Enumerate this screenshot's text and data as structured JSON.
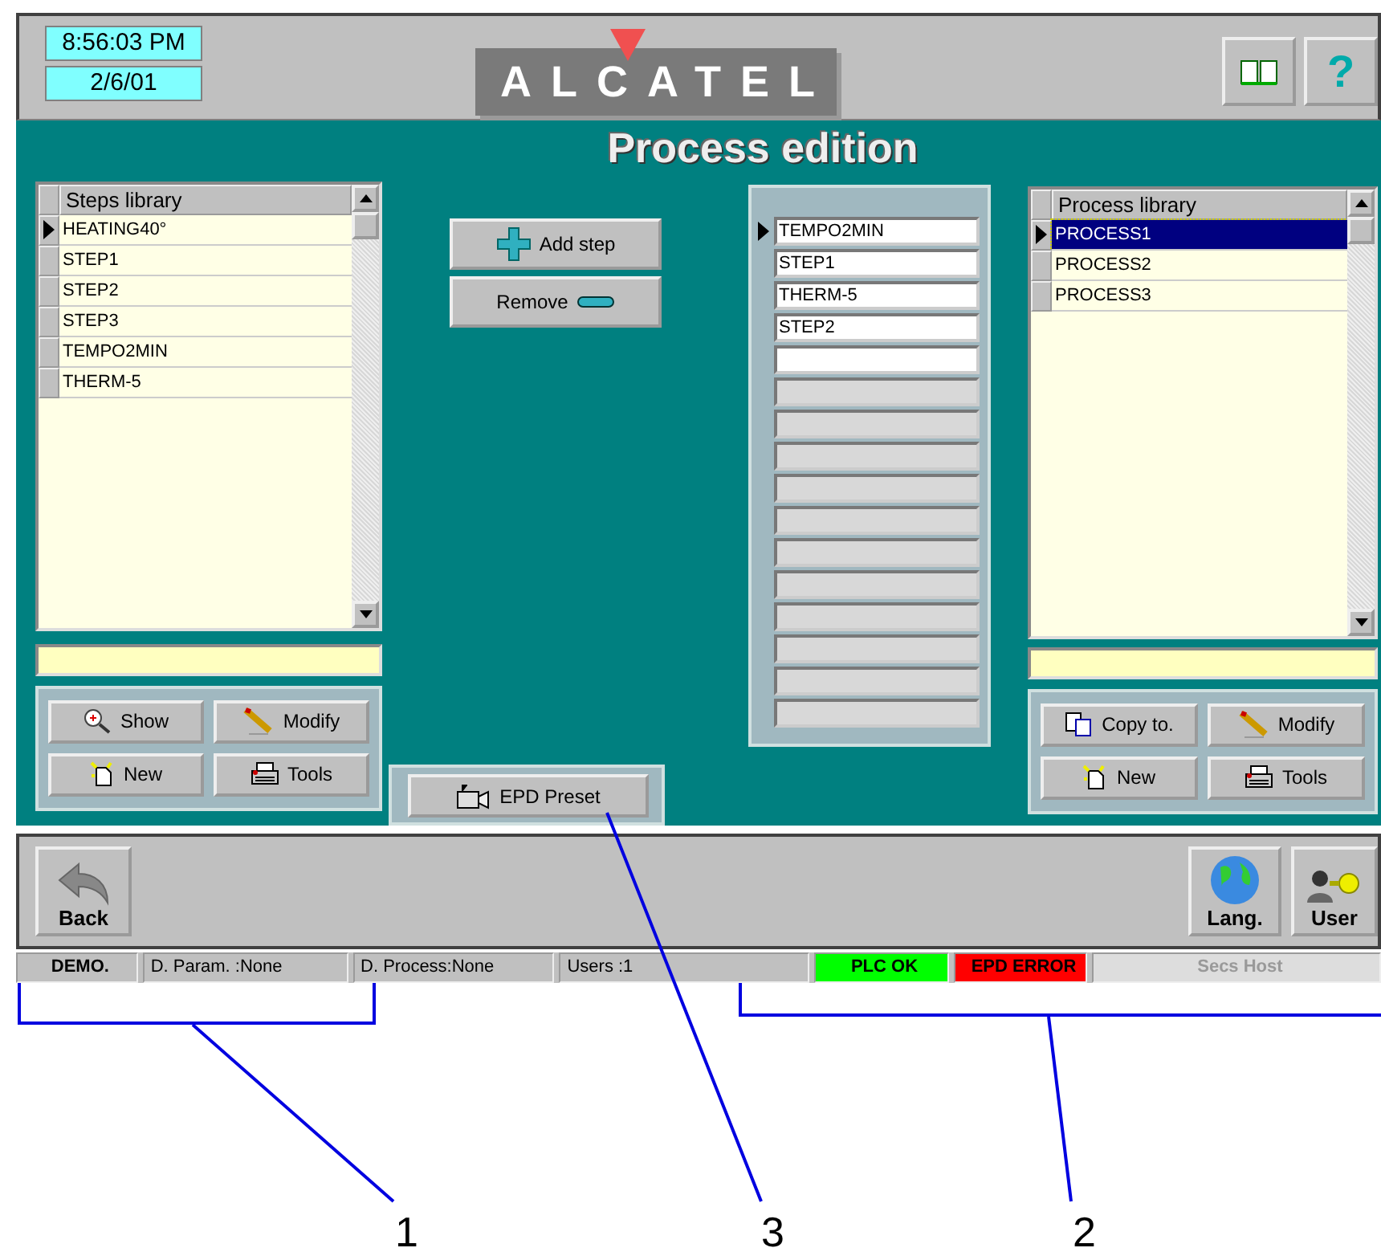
{
  "header": {
    "time": "8:56:03 PM",
    "date": "2/6/01",
    "logo": "ALCATEL",
    "help_button": "?"
  },
  "title": "Process edition",
  "steps_library": {
    "header": "Steps library",
    "rows": [
      {
        "name": "HEATING40°",
        "selected": true
      },
      {
        "name": "STEP1",
        "selected": false
      },
      {
        "name": "STEP2",
        "selected": false
      },
      {
        "name": "STEP3",
        "selected": false
      },
      {
        "name": "TEMPO2MIN",
        "selected": false
      },
      {
        "name": "THERM-5",
        "selected": false
      }
    ]
  },
  "steps_buttons": [
    {
      "label": "Show",
      "kind": "show"
    },
    {
      "label": "Modify",
      "kind": "modify"
    },
    {
      "label": "New",
      "kind": "new"
    },
    {
      "label": "Tools",
      "kind": "tools"
    }
  ],
  "edit_buttons": [
    {
      "label": "Add step",
      "kind": "add"
    },
    {
      "label": "Remove",
      "kind": "remove"
    }
  ],
  "epd_button": "EPD Preset",
  "process_steps": [
    {
      "kind": "filled",
      "text": "TEMPO2MIN",
      "selected": true
    },
    {
      "kind": "filled",
      "text": "STEP1",
      "selected": false
    },
    {
      "kind": "filled",
      "text": "THERM-5",
      "selected": false
    },
    {
      "kind": "filled",
      "text": "STEP2",
      "selected": false
    },
    {
      "kind": "blank"
    },
    {
      "kind": "unused"
    },
    {
      "kind": "unused"
    },
    {
      "kind": "unused"
    },
    {
      "kind": "unused"
    },
    {
      "kind": "unused"
    },
    {
      "kind": "unused"
    },
    {
      "kind": "unused"
    },
    {
      "kind": "unused"
    },
    {
      "kind": "unused"
    },
    {
      "kind": "unused"
    },
    {
      "kind": "unused"
    }
  ],
  "process_library": {
    "header": "Process library",
    "rows": [
      {
        "name": "PROCESS1",
        "selected": true
      },
      {
        "name": "PROCESS2",
        "selected": false
      },
      {
        "name": "PROCESS3",
        "selected": false
      }
    ]
  },
  "process_buttons": [
    {
      "label": "Copy to.",
      "kind": "copy"
    },
    {
      "label": "Modify",
      "kind": "modify"
    },
    {
      "label": "New",
      "kind": "new"
    },
    {
      "label": "Tools",
      "kind": "tools"
    }
  ],
  "bottom_bar": [
    {
      "label": "Back",
      "kind": "back"
    },
    {
      "label": "Lang.",
      "kind": "lang"
    },
    {
      "label": "User",
      "kind": "user"
    }
  ],
  "status_bar": [
    {
      "text": "DEMO.",
      "kind": "bold"
    },
    {
      "text": "D. Param. :None",
      "kind": "plain"
    },
    {
      "text": "D. Process:None",
      "kind": "plain"
    },
    {
      "text": "Users :1",
      "kind": "plain"
    },
    {
      "text": "PLC OK",
      "kind": "indicator",
      "color": "#00ff00"
    },
    {
      "text": "EPD ERROR",
      "kind": "indicator",
      "color": "#ff0000"
    },
    {
      "text": "Secs Host",
      "kind": "disabled"
    }
  ],
  "callouts": [
    {
      "number": "1"
    },
    {
      "number": "3"
    },
    {
      "number": "2"
    }
  ]
}
